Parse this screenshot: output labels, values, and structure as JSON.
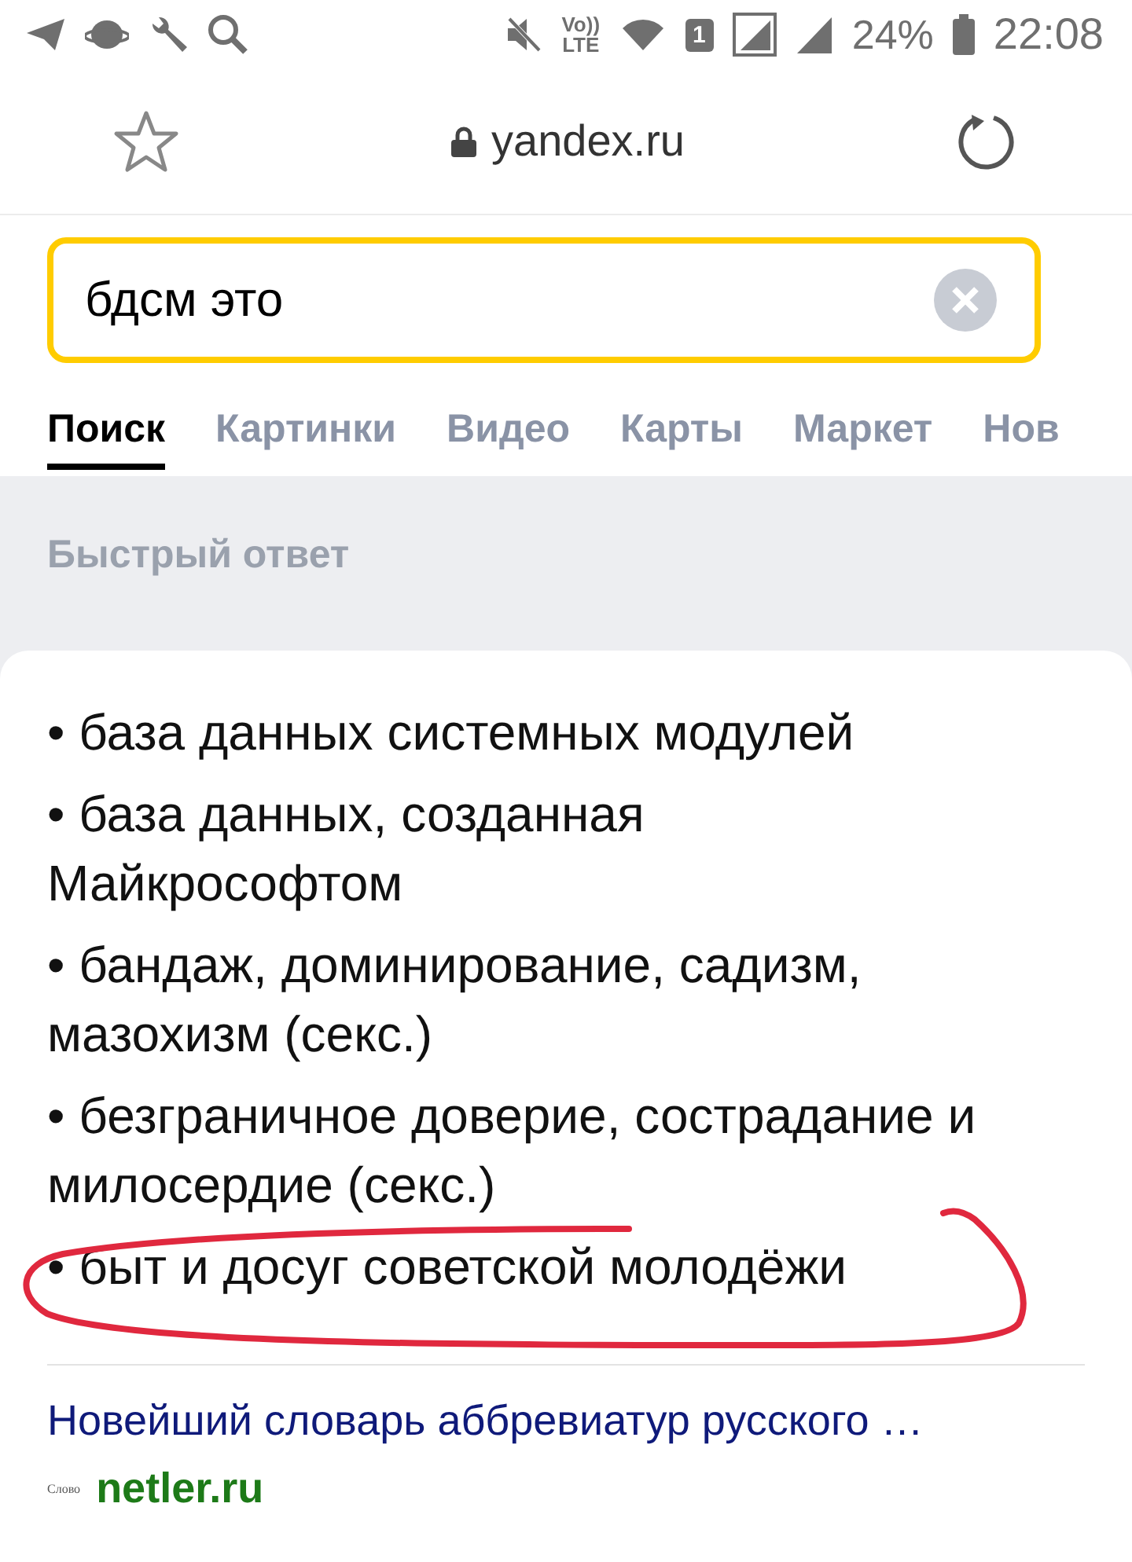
{
  "status_bar": {
    "volte": "Vo))",
    "lte": "LTE",
    "sim": "1",
    "battery": "24%",
    "time": "22:08"
  },
  "address_bar": {
    "domain": "yandex.ru"
  },
  "search": {
    "value": "бдсм это"
  },
  "tabs": [
    {
      "label": "Поиск",
      "selected": true
    },
    {
      "label": "Картинки",
      "selected": false
    },
    {
      "label": "Видео",
      "selected": false
    },
    {
      "label": "Карты",
      "selected": false
    },
    {
      "label": "Маркет",
      "selected": false
    },
    {
      "label": "Нов",
      "selected": false
    }
  ],
  "quick_answer": {
    "heading": "Быстрый ответ",
    "items": [
      "• база данных системных модулей",
      "• база данных, созданная Майкрософтом",
      "• бандаж, доминирование, садизм, мазохизм (секс.)",
      "• безграничное доверие, сострадание и милосердие (секс.)",
      "• быт и досуг советской молодёжи"
    ],
    "source_title": "Новейший словарь аббревиатур русского …",
    "source_logo": "Слово",
    "source_domain": "netler.ru"
  }
}
